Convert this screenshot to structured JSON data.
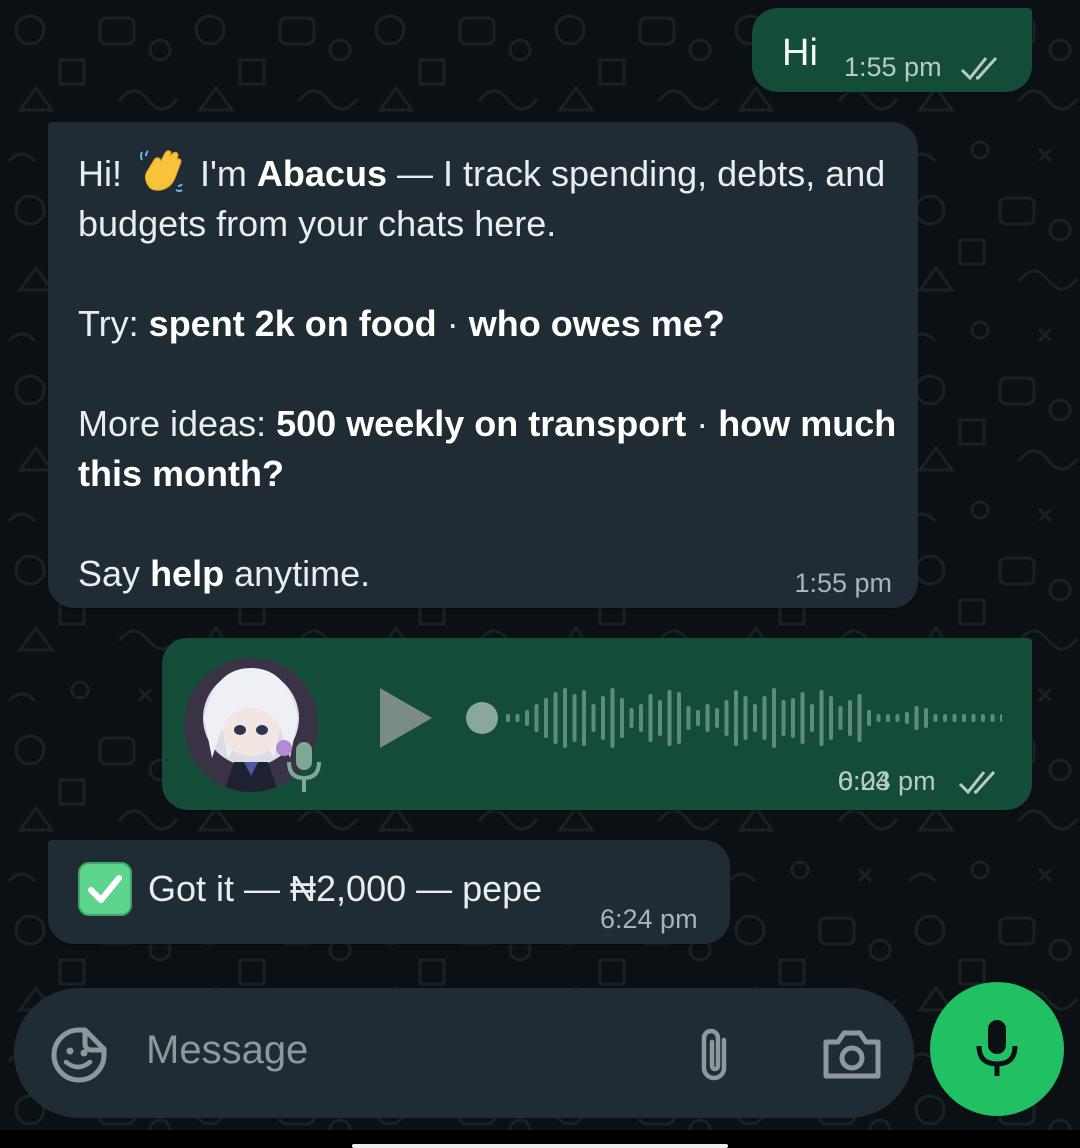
{
  "messages": {
    "hi": {
      "text": "Hi",
      "time": "1:55 pm",
      "status_icon": "double-check-icon"
    },
    "welcome": {
      "line1_a": "Hi!",
      "line1_b": "I'm",
      "bot_name": "Abacus",
      "line1_c": "— I track spending, debts, and budgets from your chats here.",
      "try_label": "Try:",
      "example_1": "spent 2k on food",
      "separator": "·",
      "example_2": "who owes me?",
      "more_label": "More ideas:",
      "example_3": "500 weekly on transport",
      "example_4": "how much this month?",
      "say": "Say",
      "help_word": "help",
      "anytime": "anytime.",
      "time": "1:55 pm"
    },
    "voice": {
      "duration": "0:04",
      "time": "6:23 pm",
      "progress": 0.0,
      "status_icon": "double-check-icon"
    },
    "got": {
      "text": "Got it — ₦2,000 — pepe",
      "time": "6:24 pm",
      "icon": "check-mark-button-icon"
    }
  },
  "composer": {
    "placeholder": "Message",
    "icons": [
      "sticker-icon",
      "paperclip-icon",
      "camera-icon",
      "mic-icon"
    ]
  },
  "colors": {
    "background": "#0b1014",
    "outgoing_bubble": "#144d37",
    "incoming_bubble": "#1f2c33",
    "accent_green": "#21c063"
  }
}
